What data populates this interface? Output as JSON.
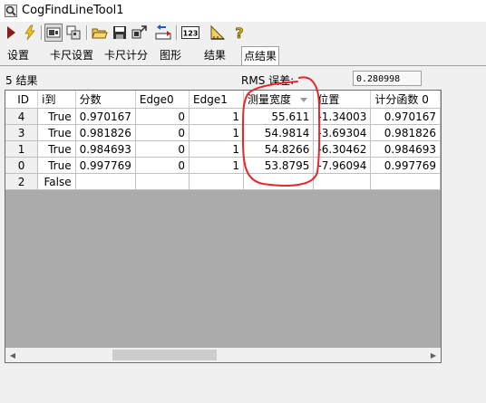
{
  "window": {
    "title": "CogFindLineTool1"
  },
  "toolbar": {
    "buttons": [
      "run-icon",
      "electric-icon",
      "display-icon",
      "image-icon",
      "open-icon",
      "save-icon",
      "import-icon",
      "export-icon",
      "counter-icon",
      "ruler-icon",
      "help-icon"
    ]
  },
  "tabs": [
    "设置",
    "卡尺设置",
    "卡尺计分",
    "图形",
    "结果",
    "点结果"
  ],
  "results": {
    "count_label": "5 结果",
    "rms_label": "RMS 误差:",
    "rms_value": "0.280998"
  },
  "grid": {
    "headers": [
      "ID",
      "i到",
      "分数",
      "Edge0",
      "Edge1",
      "测量宽度",
      "位置",
      "计分函数 0"
    ],
    "rows": [
      [
        "4",
        "True",
        "0.970167",
        "0",
        "1",
        "55.611",
        "-1.34003",
        "0.970167"
      ],
      [
        "3",
        "True",
        "0.981826",
        "0",
        "1",
        "54.9814",
        "-3.69304",
        "0.981826"
      ],
      [
        "1",
        "True",
        "0.984693",
        "0",
        "1",
        "54.8266",
        "-6.30462",
        "0.984693"
      ],
      [
        "0",
        "True",
        "0.997769",
        "0",
        "1",
        "53.8795",
        "-7.96094",
        "0.997769"
      ],
      [
        "2",
        "False",
        "",
        "",
        "",
        "",
        "",
        ""
      ]
    ]
  },
  "colors": {
    "annotation": "#e8262b",
    "grid_background": "#ababab"
  }
}
